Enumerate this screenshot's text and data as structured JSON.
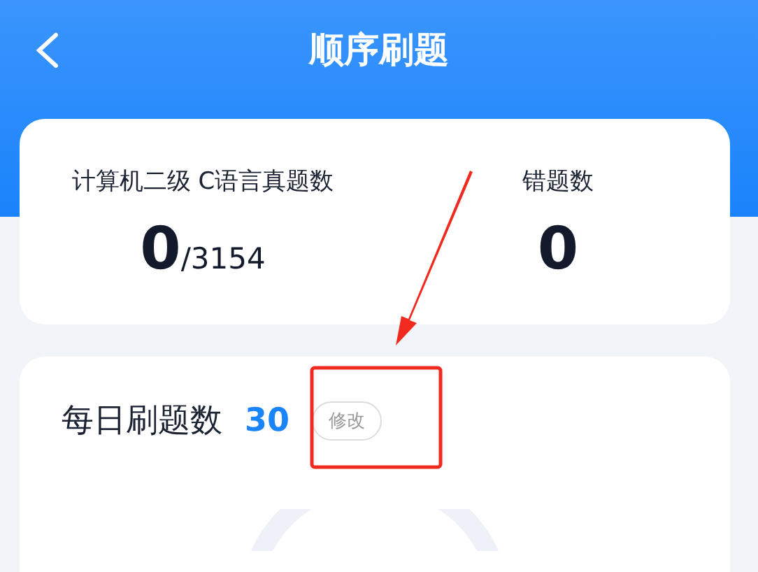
{
  "header": {
    "title": "顺序刷题"
  },
  "stats": [
    {
      "label": "计算机二级 C语言真题数",
      "value": "0",
      "total": "/3154"
    },
    {
      "label": "错题数",
      "value": "0"
    }
  ],
  "daily": {
    "label": "每日刷题数",
    "value": "30",
    "button": "修改"
  }
}
